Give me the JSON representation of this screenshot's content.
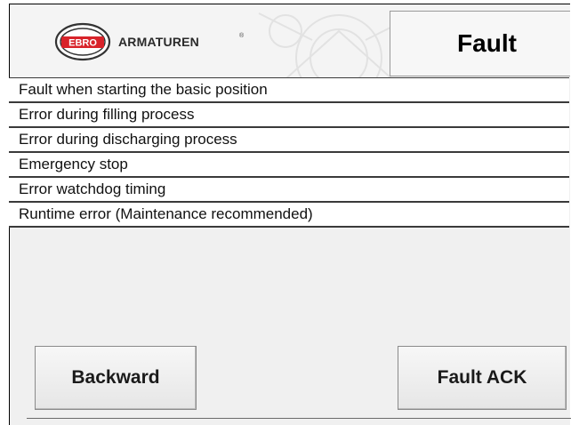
{
  "header": {
    "brand_mark": "EBRO",
    "brand_name": "ARMATUREN",
    "brand_reg": "®",
    "title": "Fault"
  },
  "faults": [
    "Fault when starting the basic position",
    "Error during filling process",
    "Error during discharging process",
    "Emergency stop",
    "Error watchdog timing",
    "Runtime error (Maintenance recommended)"
  ],
  "buttons": {
    "backward": "Backward",
    "fault_ack": "Fault ACK"
  },
  "colors": {
    "logo_red": "#d8232a",
    "panel_bg": "#f0f0f0"
  }
}
